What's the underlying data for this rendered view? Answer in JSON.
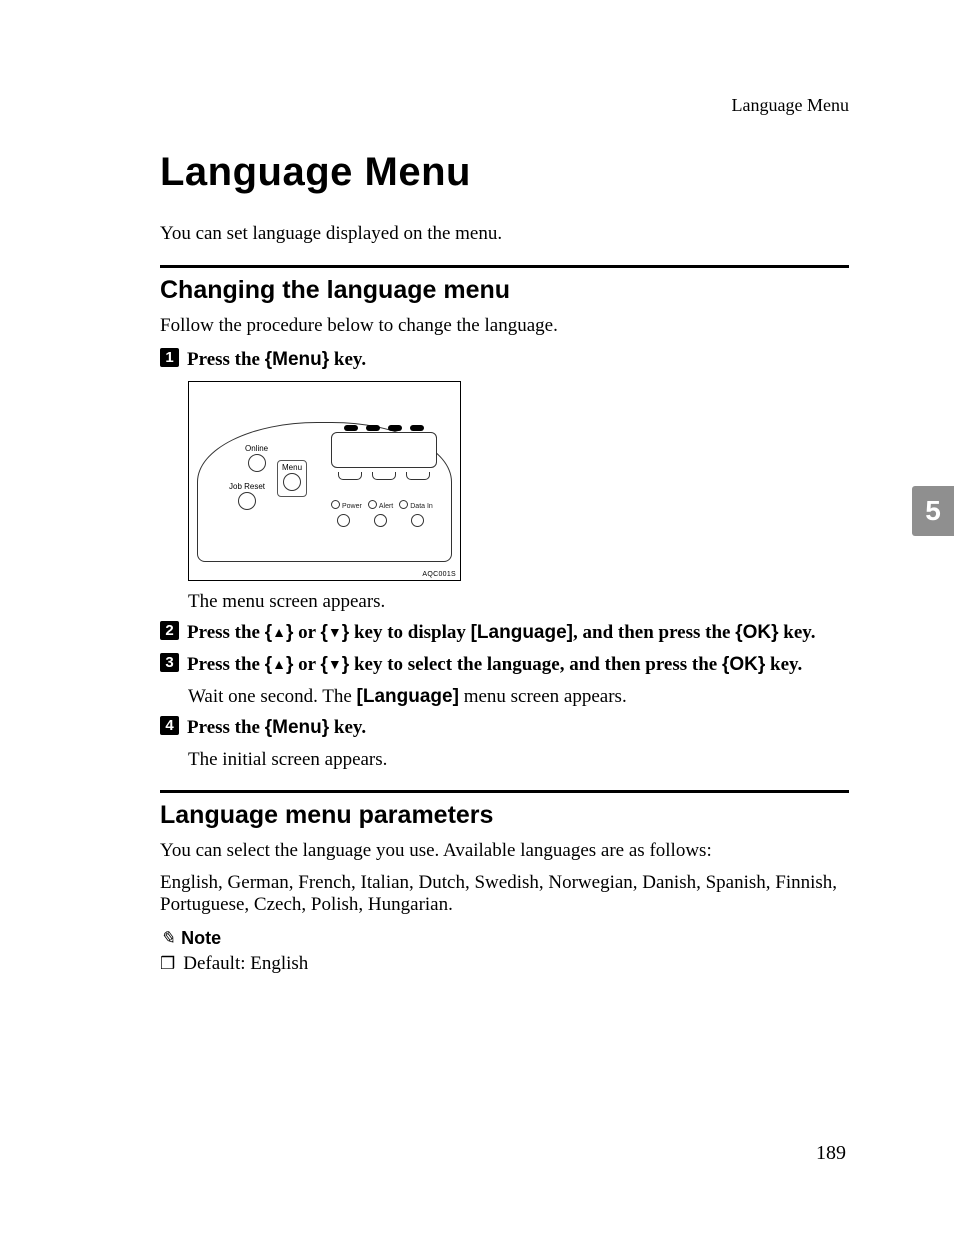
{
  "running_head": "Language Menu",
  "title": "Language Menu",
  "intro": "You can set language displayed on the menu.",
  "section1": {
    "heading": "Changing the language menu",
    "lead": "Follow the procedure below to change the language.",
    "steps": {
      "s1": {
        "num": "1",
        "pre": "Press the ",
        "key_open": "{",
        "key_label": "Menu",
        "key_close": "}",
        "post": " key.",
        "after_fig": "The menu screen appears."
      },
      "s2": {
        "num": "2",
        "t1": "Press the ",
        "upo": "{",
        "up": "▲",
        "upc": "}",
        "t2": " or ",
        "dno": "{",
        "dn": "▼",
        "dnc": "}",
        "t3": " key to display ",
        "lang": "[Language]",
        "t4": ", and then press the ",
        "oko": "{",
        "ok": "OK",
        "okc": "}",
        "t5": " key."
      },
      "s3": {
        "num": "3",
        "t1": "Press the ",
        "upo": "{",
        "up": "▲",
        "upc": "}",
        "t2": " or ",
        "dno": "{",
        "dn": "▼",
        "dnc": "}",
        "t3": " key to select the language, and then press the ",
        "oko": "{",
        "ok": "OK",
        "okc": "}",
        "t5": " key.",
        "after_a": "Wait one second. The ",
        "after_lang": "[Language]",
        "after_b": " menu screen appears."
      },
      "s4": {
        "num": "4",
        "pre": "Press the ",
        "key_open": "{",
        "key_label": "Menu",
        "key_close": "}",
        "post": " key.",
        "after": "The initial screen appears."
      }
    }
  },
  "figure": {
    "online": "Online",
    "menu": "Menu",
    "job_reset": "Job Reset",
    "power": "Power",
    "alert": "Alert",
    "data": "Data In",
    "code": "AQC001S"
  },
  "section2": {
    "heading": "Language menu parameters",
    "p1": "You can select the language you use. Available languages are as follows:",
    "p2": "English, German, French, Italian, Dutch, Swedish, Norwegian, Danish, Spanish, Finnish, Portuguese, Czech, Polish, Hungarian.",
    "note_label": "Note",
    "note_item": "Default: English"
  },
  "chapter_tab": "5",
  "page_number": "189"
}
